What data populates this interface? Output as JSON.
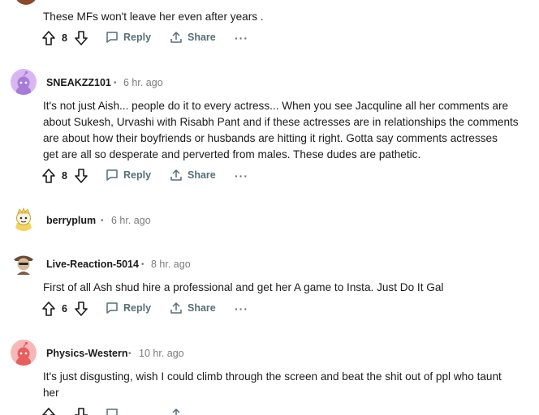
{
  "thread": {
    "top_comment": {
      "text": "These MFs won't leave her even after years .",
      "votes": "8",
      "reply": "Reply",
      "share": "Share",
      "more": "···"
    },
    "comments": [
      {
        "username": "SNEAKZZ101",
        "time": "6 hr. ago",
        "text_lines": [
          "It's not just Aish... people do it to every actress... When you see Jacquline all her comments are",
          "about Sukesh, Urvashi with Risabh Pant and if these actresses are in relationships the comments",
          "are about how their boyfriends or husbands are hitting it right. Gotta say comments actresses",
          "get are all so desperate and perverted from males. These dudes are pathetic."
        ],
        "votes": "8",
        "reply": "Reply",
        "share": "Share",
        "more": "···"
      },
      {
        "username": "berryplum",
        "time": "6 hr. ago"
      },
      {
        "username": "Live-Reaction-5014",
        "time": "8 hr. ago",
        "text_lines": [
          "First of all Ash shud hire a professional and get her A game to Insta. Just Do It Gal"
        ],
        "votes": "6",
        "reply": "Reply",
        "share": "Share",
        "more": "···"
      },
      {
        "username": "Physics-Western",
        "time": "10 hr. ago",
        "text_lines": [
          "It's just disgusting, wish I could climb through the screen and beat the shit out of ppl who taunt",
          "her"
        ]
      }
    ],
    "separator": "•"
  }
}
